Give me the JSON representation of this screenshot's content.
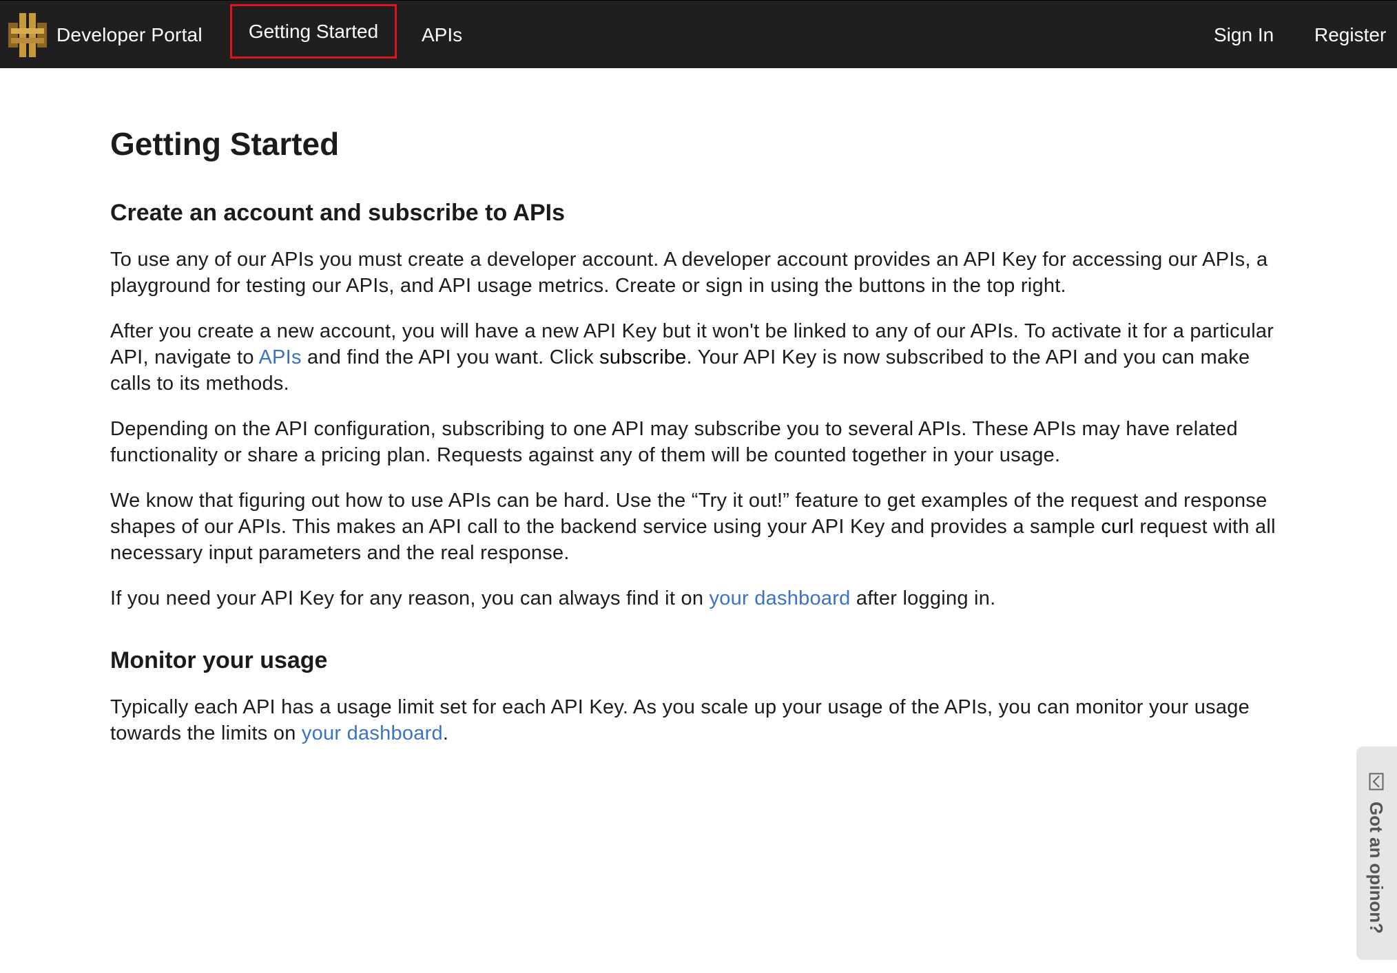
{
  "navbar": {
    "brand_label": "Developer Portal",
    "brand_icon": "api-gateway-logo-icon",
    "brand_colors": [
      "#c69a3b",
      "#8a6420"
    ],
    "items": [
      {
        "label": "Getting Started",
        "active": true,
        "highlight_color": "#e0141e"
      },
      {
        "label": "APIs",
        "active": false
      }
    ],
    "right_items": [
      {
        "label": "Sign In"
      },
      {
        "label": "Register"
      }
    ]
  },
  "main": {
    "title": "Getting Started",
    "section1": {
      "title": "Create an account and subscribe to APIs",
      "p1": "To use any of our APIs you must create a developer account. A developer account provides an API Key for accessing our APIs, a playground for testing our APIs, and API usage metrics. Create or sign in using the buttons in the top right.",
      "p2_before": "After you create a new account, you will have a new API Key but it won't be linked to any of our APIs. To activate it for a particular API, navigate to ",
      "p2_link": "APIs",
      "p2_middle": " and find the API you want. Click ",
      "p2_bold": "subscribe",
      "p2_after": ". Your API Key is now subscribed to the API and you can make calls to its methods.",
      "p3": "Depending on the API configuration, subscribing to one API may subscribe you to several APIs. These APIs may have related functionality or share a pricing plan. Requests against any of them will be counted together in your usage.",
      "p4_before": "We know that figuring out how to use APIs can be hard. Use the “Try it out!” feature to get examples of the request and response shapes of our APIs. This makes an API call to the backend service using your API Key and provides a sample ",
      "p4_code": "curl",
      "p4_after": " request with all necessary input parameters and the real response.",
      "p5_before": "If you need your API Key for any reason, you can always find it on ",
      "p5_link": "your dashboard",
      "p5_after": " after logging in."
    },
    "section2": {
      "title": "Monitor your usage",
      "p1_before": "Typically each API has a usage limit set for each API Key. As you scale up your usage of the APIs, you can monitor your usage towards the limits on ",
      "p1_link": "your dashboard",
      "p1_after": "."
    },
    "link_color": "#3a73c4"
  },
  "feedback": {
    "label": "Got an opinon?",
    "icon": "feedback-icon"
  }
}
